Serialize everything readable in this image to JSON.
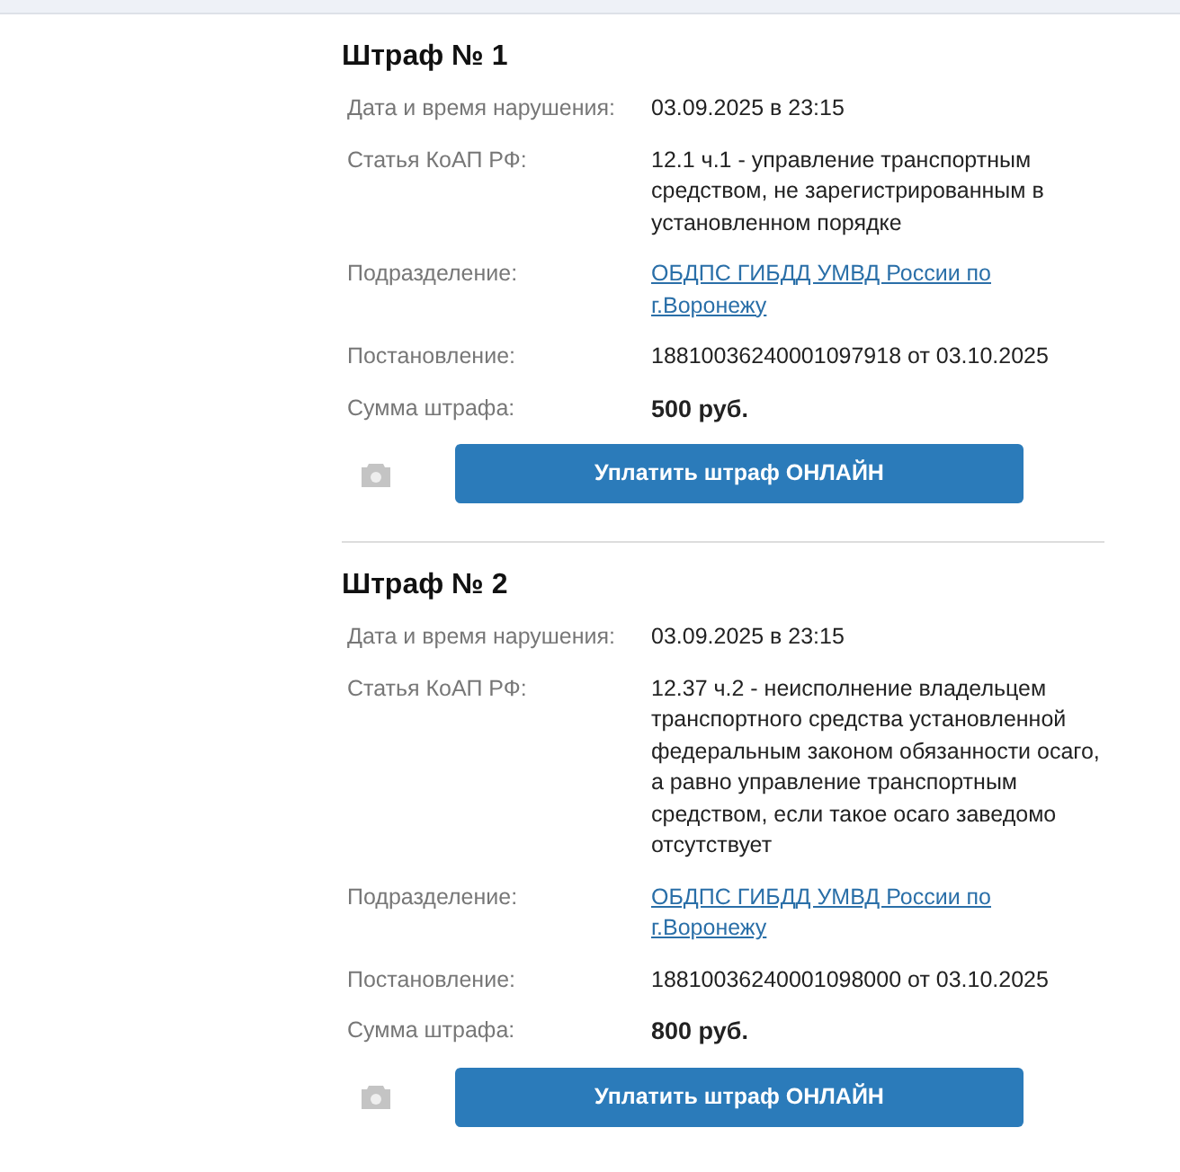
{
  "fines": [
    {
      "title": "Штраф № 1",
      "fields": [
        {
          "kind": "text",
          "label": "Дата и время нарушения:",
          "value": "03.09.2025 в 23:15"
        },
        {
          "kind": "text",
          "label": "Статья КоАП РФ:",
          "value": "12.1 ч.1 - управление транспортным средством, не зарегистрированным в установленном порядке"
        },
        {
          "kind": "link",
          "label": "Подразделение:",
          "value": "ОБДПС ГИБДД УМВД России по г.Воронежу"
        },
        {
          "kind": "text",
          "label": "Постановление:",
          "value": "18810036240001097918 от 03.10.2025"
        },
        {
          "kind": "amount",
          "label": "Сумма штрафа:",
          "value": "500 руб."
        }
      ],
      "pay_button": "Уплатить штраф ОНЛАЙН"
    },
    {
      "title": "Штраф № 2",
      "fields": [
        {
          "kind": "text",
          "label": "Дата и время нарушения:",
          "value": "03.09.2025 в 23:15"
        },
        {
          "kind": "text",
          "label": "Статья КоАП РФ:",
          "value": "12.37 ч.2 - неисполнение владельцем транспортного средства установленной федеральным законом обязанности осаго, а равно управление транспортным средством, если такое осаго заведомо отсутствует"
        },
        {
          "kind": "link",
          "label": "Подразделение:",
          "value": "ОБДПС ГИБДД УМВД России по г.Воронежу"
        },
        {
          "kind": "text",
          "label": "Постановление:",
          "value": "18810036240001098000 от 03.10.2025"
        },
        {
          "kind": "amount",
          "label": "Сумма штрафа:",
          "value": "800 руб."
        }
      ],
      "pay_button": "Уплатить штраф ОНЛАЙН"
    }
  ]
}
